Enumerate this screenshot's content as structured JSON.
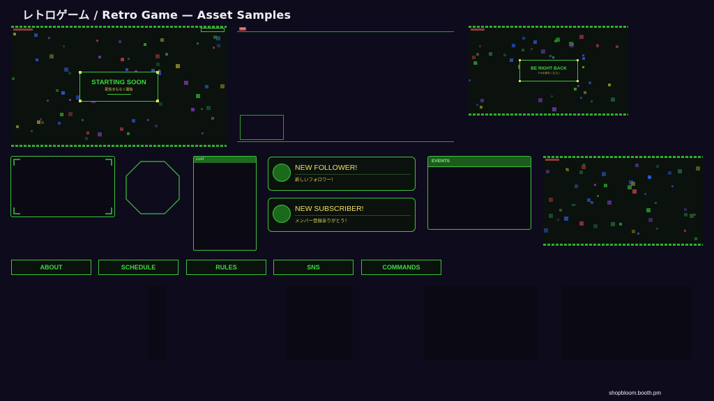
{
  "page": {
    "title": "レトロゲーム / Retro Game — Asset Samples",
    "credit": "shopbloom.booth.pm"
  },
  "scenes": {
    "starting": {
      "title": "STARTING SOON",
      "subtitle": "配信まもなく開始"
    },
    "brb": {
      "title": "BE RIGHT BACK",
      "subtitle": "少々お待ちください"
    },
    "live_badge": "LIVE"
  },
  "chat": {
    "header": "CHAT"
  },
  "events": {
    "header": "EVENTS"
  },
  "alerts": [
    {
      "title": "NEW FOLLOWER!",
      "subtitle": "新しいフォロワー！"
    },
    {
      "title": "NEW SUBSCRIBER!",
      "subtitle": "メンバー登録ありがとう！"
    }
  ],
  "nav": [
    {
      "label": "ABOUT"
    },
    {
      "label": "SCHEDULE"
    },
    {
      "label": "RULES"
    },
    {
      "label": "SNS"
    },
    {
      "label": "COMMANDS"
    }
  ],
  "colors": {
    "background": "#0e0b1c",
    "accent_green": "#3cc43c",
    "text_green": "#3cdc3c",
    "text_yellow": "#f0e060",
    "panel": "#0b110d"
  }
}
